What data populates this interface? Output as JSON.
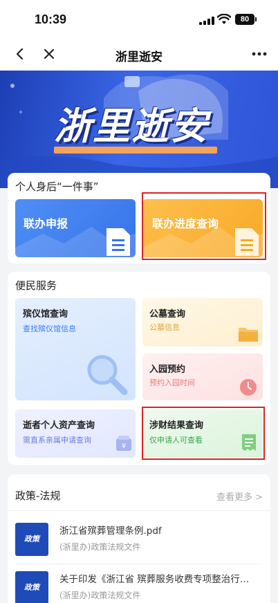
{
  "status_bar": {
    "time": "10:39",
    "battery": "80"
  },
  "nav": {
    "title": "浙里逝安"
  },
  "banner": {
    "title": "浙里逝安"
  },
  "section1": {
    "title": "个人身后“一件事”",
    "tiles": [
      {
        "label": "联办申报"
      },
      {
        "label": "联办进度查询"
      }
    ]
  },
  "section2": {
    "title": "便民服务",
    "tiles": [
      {
        "label": "殡仪馆查询",
        "sub": "查找殡仪馆信息"
      },
      {
        "label": "公墓查询",
        "sub": "公墓信息"
      },
      {
        "label": "入园预约",
        "sub": "预约入园时间"
      },
      {
        "label": "逝者个人资产查询",
        "sub": "需直系亲属申请查询"
      },
      {
        "label": "涉财结果查询",
        "sub": "仅申请人可查看"
      }
    ]
  },
  "policy": {
    "title": "政策-法规",
    "more": "查看更多 >",
    "thumb_label": "政策",
    "items": [
      {
        "name": "浙江省殡葬管理条例.pdf",
        "sub": "(浙里办)政策法规文件"
      },
      {
        "name": "关于印发《浙江省 殡葬服务收费专项整治行动...",
        "sub": "(浙里办)政策法规文件"
      }
    ]
  },
  "colors": {
    "blue_tile": "#3a7bf0",
    "orange_tile": "#fbb43a",
    "highlight_border": "#e02020"
  }
}
